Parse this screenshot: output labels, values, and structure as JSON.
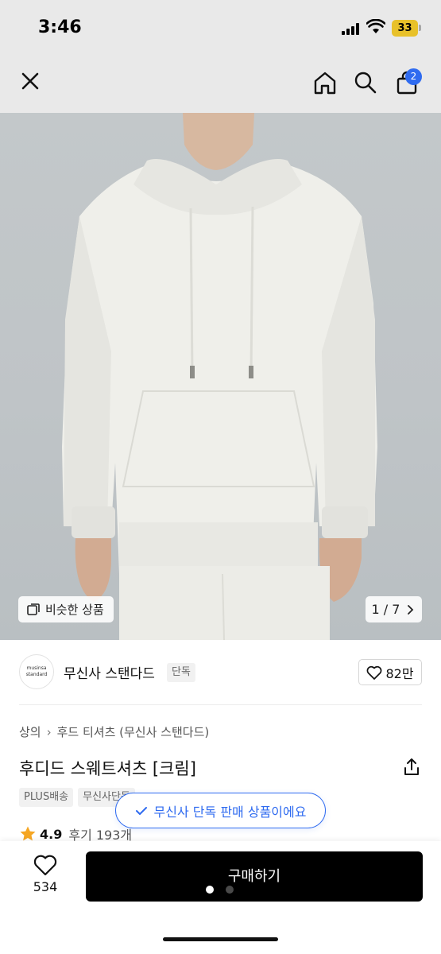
{
  "status_bar": {
    "time": "3:46",
    "battery": "33",
    "battery_color": "#e8c12a"
  },
  "nav": {
    "cart_count": "2",
    "badge_color": "#2f6bf0"
  },
  "gallery": {
    "similar_label": "비슷한 상품",
    "page_indicator": "1 / 7",
    "icons": [
      "close-icon",
      "home-icon",
      "search-icon",
      "cart-icon"
    ]
  },
  "brand": {
    "logo_line1": "musinsa",
    "logo_line2": "standard",
    "name": "무신사 스탠다드",
    "badge": "단독",
    "likes": "82만"
  },
  "product": {
    "breadcrumb": [
      "상의",
      "후드 티셔츠 (무신사 스탠다드)"
    ],
    "title": "후디드 스웨트셔츠 [크림]",
    "tags": [
      "PLUS배송",
      "무신사단독"
    ],
    "exclusive_notice": "무신사 단독 판매 상품이에요",
    "rating": "4.9",
    "reviews": "후기 193개"
  },
  "bottom": {
    "wish_count": "534",
    "buy_label": "구매하기",
    "accent_color": "#000000"
  }
}
